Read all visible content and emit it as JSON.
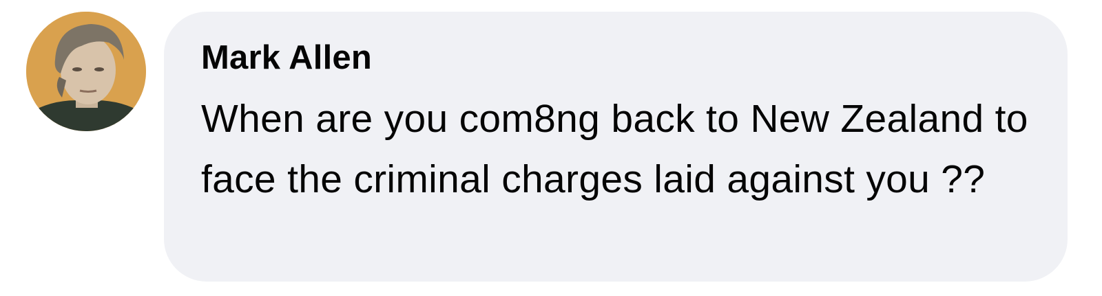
{
  "comment": {
    "author": "Mark Allen",
    "text": "When are you com8ng back to New Zealand to face the criminal charges laid against you ??",
    "avatar_icon": "profile-photo"
  },
  "colors": {
    "bubble_background": "#f0f1f5",
    "text": "#050505",
    "avatar_background": "#d9a14e"
  }
}
